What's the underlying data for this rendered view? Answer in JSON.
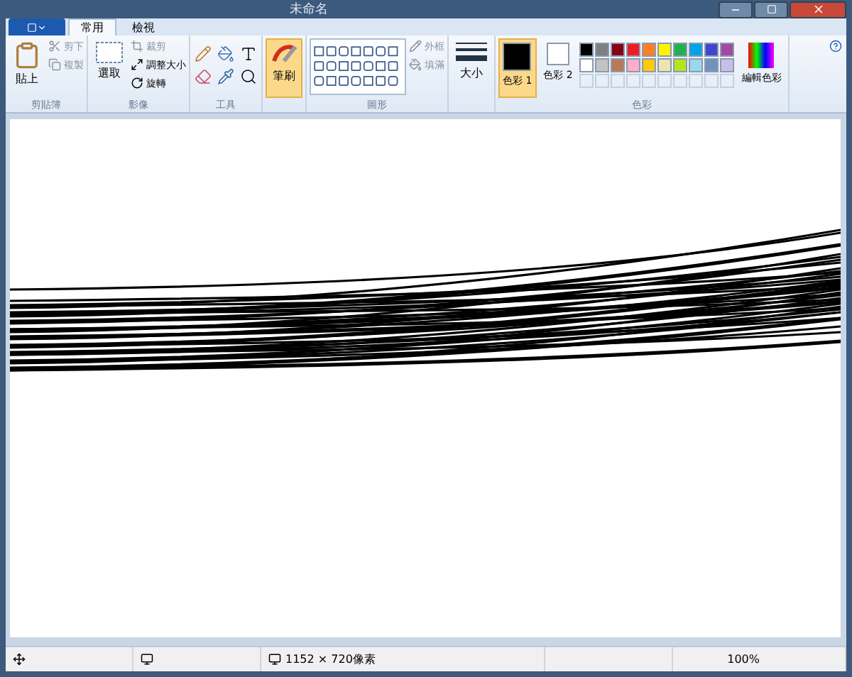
{
  "window": {
    "title": "未命名"
  },
  "tabs": [
    {
      "label": "常用",
      "selected": true
    },
    {
      "label": "檢視",
      "selected": false
    }
  ],
  "clipboard": {
    "paste": "貼上",
    "cut": "剪下",
    "copy": "複製",
    "label": "剪貼簿"
  },
  "image": {
    "select": "選取",
    "crop": "裁剪",
    "resize": "調整大小",
    "rotate": "旋轉",
    "label": "影像"
  },
  "tools": {
    "label": "工具"
  },
  "brushes": {
    "label": "筆刷",
    "selected": true
  },
  "shapes": {
    "outline": "外框",
    "fill": "填滿",
    "label": "圖形"
  },
  "size": {
    "label": "大小"
  },
  "colors": {
    "color1": {
      "label": "色彩 1",
      "color": "#000000",
      "selected": true
    },
    "color2": {
      "label": "色彩 2",
      "color": "#ffffff",
      "selected": false
    },
    "edit": "編輯色彩",
    "label": "色彩",
    "palette": [
      {
        "color": "#000000"
      },
      {
        "color": "#7f7f7f"
      },
      {
        "color": "#880015"
      },
      {
        "color": "#ed1c24"
      },
      {
        "color": "#ff7f27"
      },
      {
        "color": "#fff200"
      },
      {
        "color": "#22b14c"
      },
      {
        "color": "#00a2e8"
      },
      {
        "color": "#3f48cc"
      },
      {
        "color": "#a349a4"
      },
      {
        "color": "#ffffff"
      },
      {
        "color": "#c3c3c3"
      },
      {
        "color": "#b97a57"
      },
      {
        "color": "#ffaec9"
      },
      {
        "color": "#ffc90e"
      },
      {
        "color": "#efe4b0"
      },
      {
        "color": "#b5e61d"
      },
      {
        "color": "#99d9ea"
      },
      {
        "color": "#7092be"
      },
      {
        "color": "#c8bfe7"
      }
    ]
  },
  "status_bar": {
    "dimensions": "1152 × 720像素",
    "zoom": "100%"
  }
}
